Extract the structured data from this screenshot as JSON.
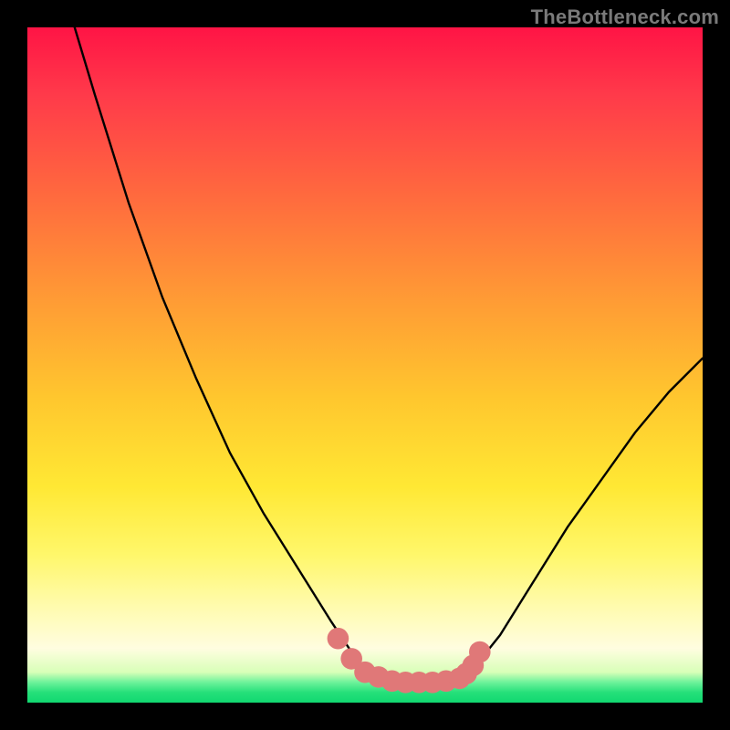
{
  "watermark": "TheBottleneck.com",
  "chart_data": {
    "type": "line",
    "title": "",
    "xlabel": "",
    "ylabel": "",
    "xlim": [
      0,
      100
    ],
    "ylim": [
      0,
      100
    ],
    "series": [
      {
        "name": "curve",
        "color": "#000000",
        "x": [
          7,
          10,
          15,
          20,
          25,
          30,
          35,
          40,
          45,
          47,
          49,
          51,
          53,
          55,
          58,
          62,
          64,
          66,
          70,
          75,
          80,
          85,
          90,
          95,
          100
        ],
        "y": [
          100,
          90,
          74,
          60,
          48,
          37,
          28,
          20,
          12,
          9,
          6,
          4.5,
          3.5,
          3,
          3,
          3,
          3.5,
          5,
          10,
          18,
          26,
          33,
          40,
          46,
          51
        ]
      }
    ],
    "markers": {
      "color": "#e07878",
      "radius": 1.6,
      "points_x": [
        46,
        48,
        50,
        52,
        54,
        56,
        58,
        60,
        62,
        64,
        65,
        66,
        67
      ],
      "points_y": [
        9.5,
        6.5,
        4.5,
        3.8,
        3.2,
        3.0,
        3.0,
        3.0,
        3.2,
        3.6,
        4.3,
        5.5,
        7.5
      ]
    },
    "background_gradient": {
      "top": "#ff1445",
      "mid": "#ffe834",
      "bottom": "#11d870"
    }
  }
}
